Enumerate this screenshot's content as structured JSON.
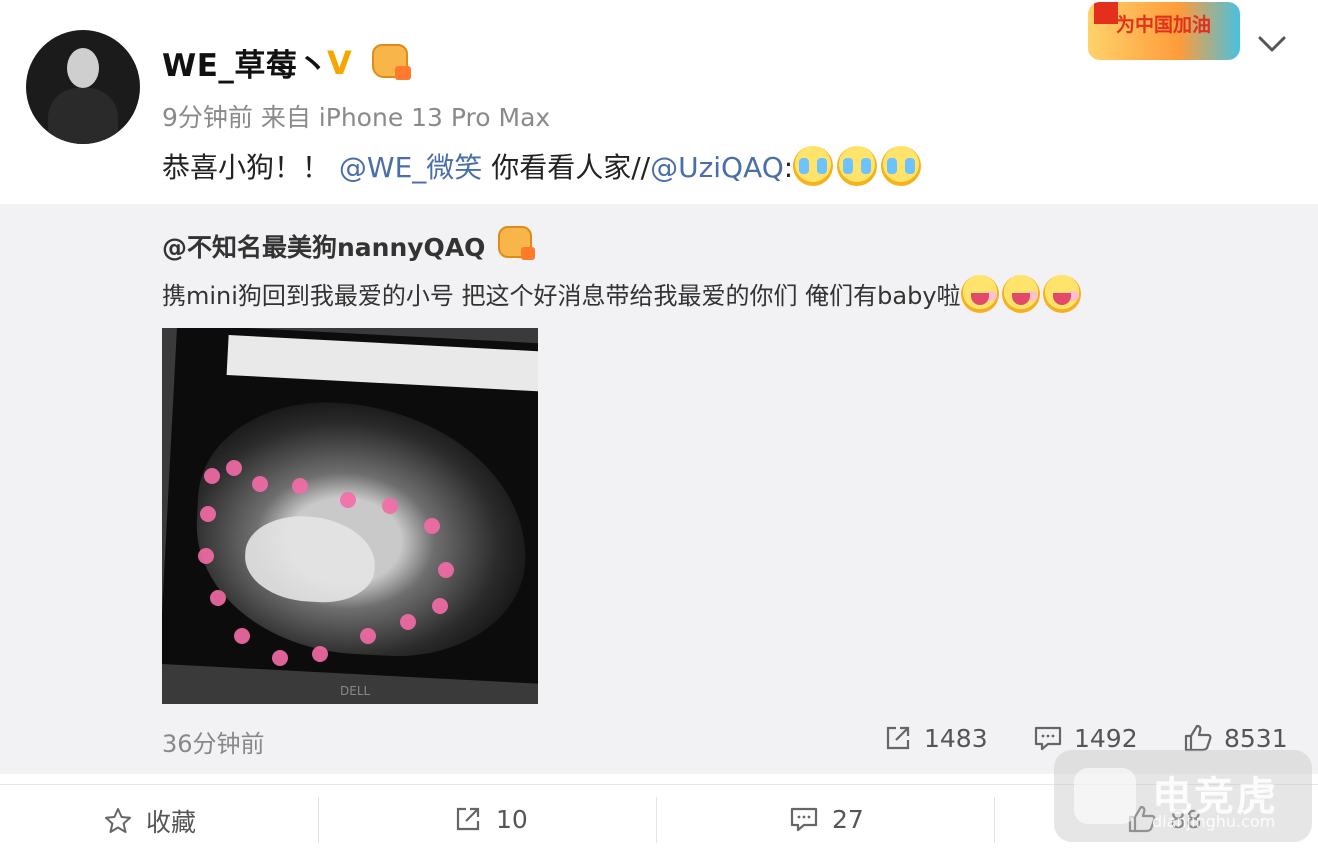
{
  "post": {
    "username": "WE_草莓丶",
    "verified_symbol": "V",
    "time": "9分钟前",
    "source": "来自 iPhone 13 Pro Max",
    "text_prefix": "恭喜小狗！！ ",
    "mention1": "@WE_微笑",
    "text_middle": " 你看看人家//",
    "mention2": "@UziQAQ",
    "text_suffix": ":",
    "event_badge": "为中国加油"
  },
  "repost": {
    "author": "@不知名最美狗nannyQAQ",
    "text": "携mini狗回到我最爱的小号 把这个好消息带给我最爱的你们 俺们有baby啦",
    "image_brand": "DELL",
    "time": "36分钟前",
    "stats": {
      "reposts": "1483",
      "comments": "1492",
      "likes": "8531"
    }
  },
  "actions": {
    "favorite": "收藏",
    "repost_count": "10",
    "comment_count": "27",
    "like_count": "88"
  },
  "watermark": {
    "name": "电竞虎",
    "url": "dianjinghu.com"
  },
  "colors": {
    "mention": "#4a6ea9",
    "verified": "#f7a600",
    "repost_bg": "#f2f2f4"
  }
}
